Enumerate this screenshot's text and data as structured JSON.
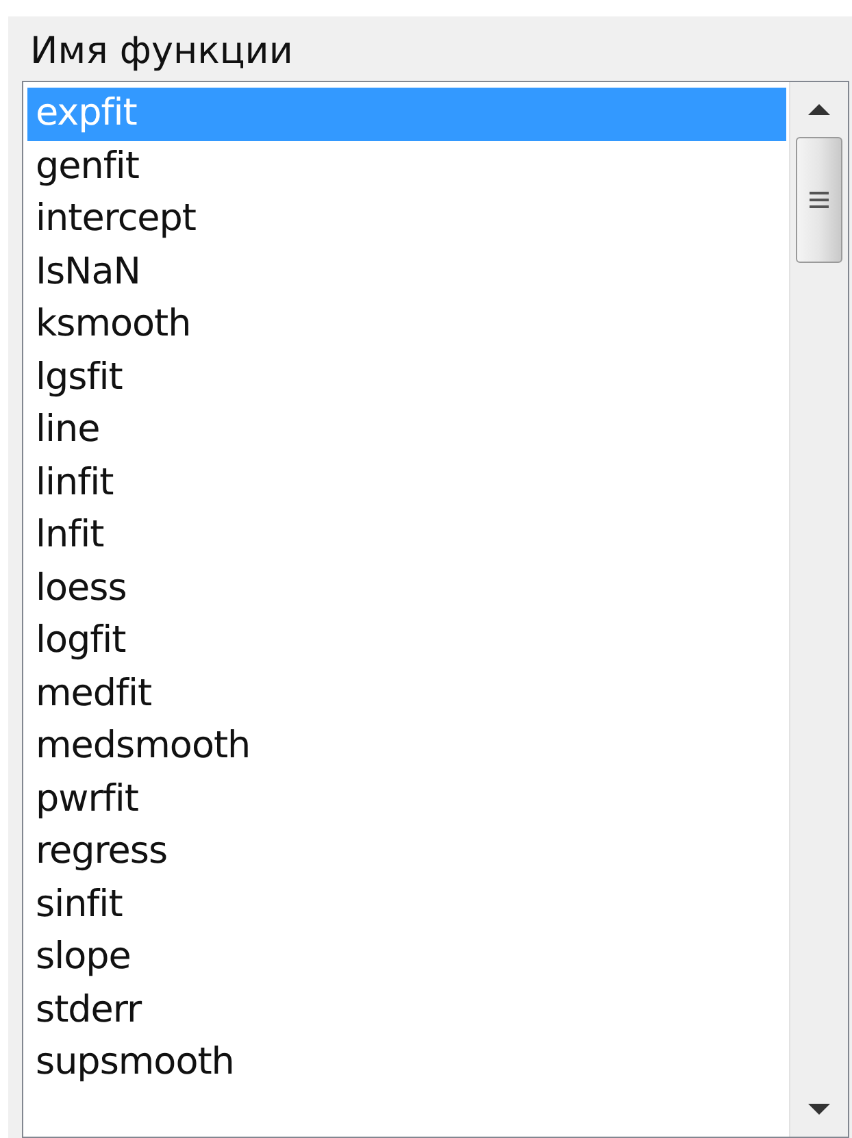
{
  "label": "Имя функции",
  "list": {
    "items": [
      {
        "text": "expfit",
        "selected": true
      },
      {
        "text": "genfit",
        "selected": false
      },
      {
        "text": "intercept",
        "selected": false
      },
      {
        "text": "IsNaN",
        "selected": false
      },
      {
        "text": "ksmooth",
        "selected": false
      },
      {
        "text": "lgsfit",
        "selected": false
      },
      {
        "text": "line",
        "selected": false
      },
      {
        "text": "linfit",
        "selected": false
      },
      {
        "text": "lnfit",
        "selected": false
      },
      {
        "text": "loess",
        "selected": false
      },
      {
        "text": "logfit",
        "selected": false
      },
      {
        "text": "medfit",
        "selected": false
      },
      {
        "text": "medsmooth",
        "selected": false
      },
      {
        "text": "pwrfit",
        "selected": false
      },
      {
        "text": "regress",
        "selected": false
      },
      {
        "text": "sinfit",
        "selected": false
      },
      {
        "text": "slope",
        "selected": false
      },
      {
        "text": "stderr",
        "selected": false
      },
      {
        "text": "supsmooth",
        "selected": false
      }
    ]
  }
}
